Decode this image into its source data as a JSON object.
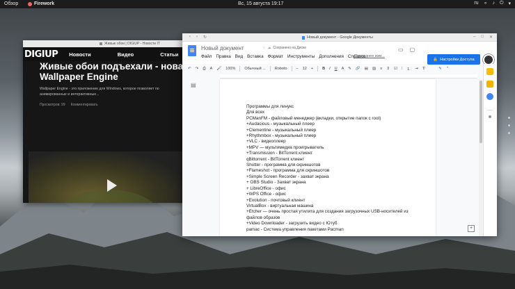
{
  "topbar": {
    "overview": "Обзор",
    "app": "Firework",
    "clock": "Вс, 15 августа  19:17",
    "lang": "ru"
  },
  "left_window": {
    "title": "Живые обои | DIGIUP - Новости IT",
    "logo": "DIGIUP",
    "nav": [
      "Новости",
      "Видео",
      "Статьи"
    ],
    "headline_line1": "Живые обои подъехали - новая подборка",
    "headline_line2": "Wallpaper Engine",
    "lead_line1": "Wallpaper Engine - это приложение для Windows, которое позволяет по",
    "lead_line2": "анимированные и интерактивные...",
    "views": "Просмотров: 99",
    "comment": "Комментировать"
  },
  "docs_window": {
    "window_title": "Новый документ - Google Документы",
    "doc_name": "Новый документ",
    "saved": "Сохранено на Диске",
    "menu": [
      "Файл",
      "Правка",
      "Вид",
      "Вставка",
      "Формат",
      "Инструменты",
      "Дополнения",
      "Справка"
    ],
    "last_edit": "Последнее изм...",
    "share": "Настройки Доступа",
    "toolbar": {
      "zoom": "100%",
      "style": "Обычный ...",
      "font": "Roboto",
      "size": "12"
    },
    "lines": [
      "Программы для линукс",
      "Для всех",
      "PCManFM - файловый менеджер (вкладки, открытие папок с root)",
      "+Audacious - музыкальный плеер",
      "+Clementine - музыкальный плеер",
      "+Rhythmbox - музыкальный плеер",
      "+VLC - видеоплеер",
      "+MPV — мультимедиа проигрыватель",
      "+Transmission - BitTorrent клиент",
      "qBittorrent - BitTorrent клиент",
      "Shutter - программа для скриншотов",
      "+Flameshot - программа для скриншотов",
      "+Simple Screen Recorder - захват экрана",
      "+ OBS Studio - Захват экрана",
      "+ LibreOffice - офис",
      "+WPS Office - офис",
      "+Evolution - почтовый клиент",
      "VirtualBox - виртуальная машина",
      "+Etcher — очень простая утилита для создания загрузочных USB-носителей из",
      "файлов образов",
      "+Video Downloader - загрузить видео с Ютуб",
      "pamac - Система управления пакетами Pacman"
    ]
  }
}
